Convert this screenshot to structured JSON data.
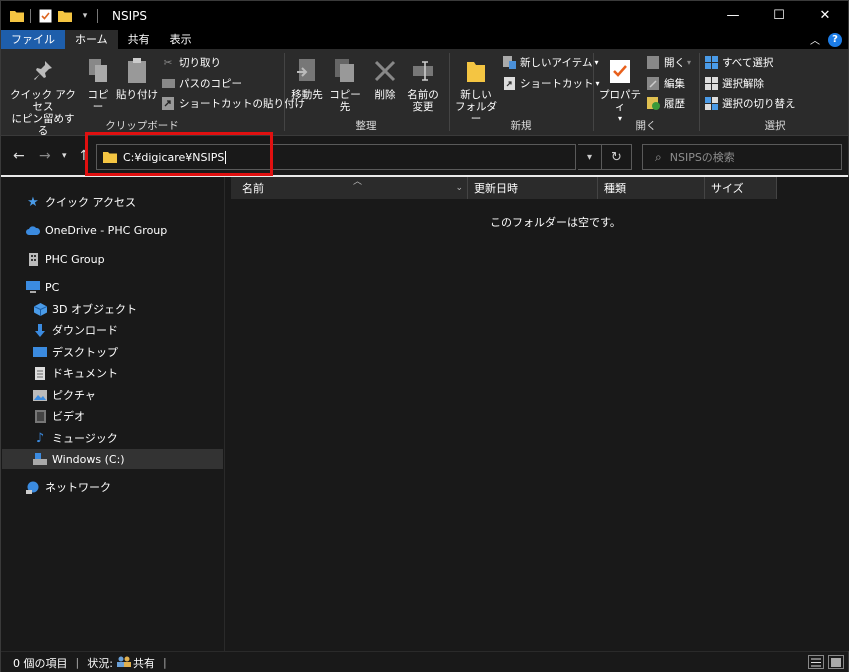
{
  "window": {
    "title": "NSIPS",
    "controls": {
      "minimize": "—",
      "maximize": "☐",
      "close": "✕"
    }
  },
  "tabs": [
    {
      "label": "ファイル"
    },
    {
      "label": "ホーム"
    },
    {
      "label": "共有"
    },
    {
      "label": "表示"
    }
  ],
  "ribbon": {
    "clipboard": {
      "label": "クリップボード",
      "pin_quick_access": "クイック アクセス\nにピン留めする",
      "pin_line1": "クイック アクセス",
      "pin_line2": "にピン留めする",
      "copy": "コピー",
      "paste": "貼り付け",
      "cut": "切り取り",
      "copy_path": "パスのコピー",
      "paste_shortcut": "ショートカットの貼り付け"
    },
    "organize": {
      "label": "整理",
      "move_to": "移動先",
      "copy_to": "コピー先",
      "delete": "削除",
      "rename_line1": "名前の",
      "rename_line2": "変更"
    },
    "new": {
      "label": "新規",
      "new_folder_line1": "新しい",
      "new_folder_line2": "フォルダー",
      "new_item": "新しいアイテム",
      "shortcut": "ショートカット"
    },
    "open": {
      "label": "開く",
      "properties": "プロパティ",
      "open": "開く",
      "edit": "編集",
      "history": "履歴"
    },
    "select": {
      "label": "選択",
      "select_all": "すべて選択",
      "select_none": "選択解除",
      "invert": "選択の切り替え"
    }
  },
  "address": {
    "path": "C:¥digicare¥NSIPS",
    "search_placeholder": "NSIPSの検索"
  },
  "nav_pane": [
    {
      "label": "クイック アクセス"
    },
    {
      "label": "OneDrive - PHC Group"
    },
    {
      "label": "PHC Group"
    },
    {
      "label": "PC"
    },
    {
      "label": "3D オブジェクト"
    },
    {
      "label": "ダウンロード"
    },
    {
      "label": "デスクトップ"
    },
    {
      "label": "ドキュメント"
    },
    {
      "label": "ピクチャ"
    },
    {
      "label": "ビデオ"
    },
    {
      "label": "ミュージック"
    },
    {
      "label": "Windows (C:)"
    },
    {
      "label": "ネットワーク"
    }
  ],
  "columns": [
    {
      "label": "名前"
    },
    {
      "label": "更新日時"
    },
    {
      "label": "種類"
    },
    {
      "label": "サイズ"
    }
  ],
  "content": {
    "empty_message": "このフォルダーは空です。"
  },
  "status": {
    "items": "0 個の項目",
    "state_label": "状況:",
    "state_value": "共有"
  },
  "colors": {
    "accent_file_tab": "#1e5eab",
    "highlight": "#e01010",
    "folder": "#f4c542"
  }
}
